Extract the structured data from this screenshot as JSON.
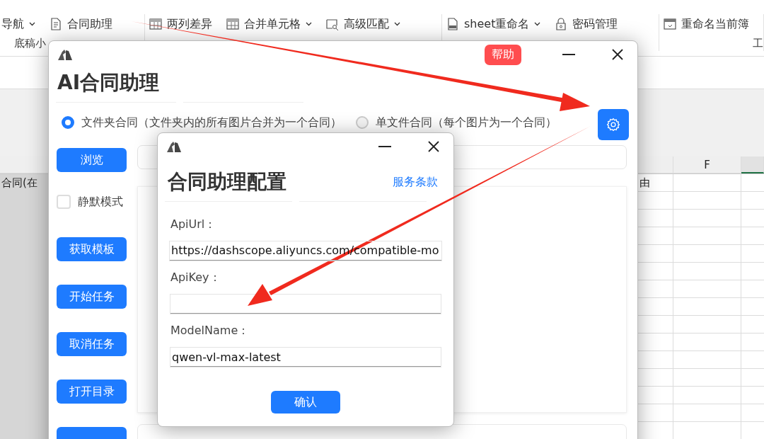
{
  "ribbon": {
    "groups": [
      {
        "label": "底稿小",
        "items": [
          {
            "label": "导航",
            "dropdown": true
          },
          {
            "label": "合同助理",
            "dropdown": false
          }
        ]
      },
      {
        "items": [
          {
            "label": "两列差异",
            "dropdown": false
          },
          {
            "label": "合并单元格",
            "dropdown": true
          },
          {
            "label": "高级匹配",
            "dropdown": true
          }
        ]
      },
      {
        "items": [
          {
            "label": "sheet重命名",
            "dropdown": true
          },
          {
            "label": "密码管理",
            "dropdown": false
          }
        ]
      },
      {
        "label": "工",
        "items": [
          {
            "label": "重命名当前簿",
            "dropdown": false
          }
        ]
      }
    ]
  },
  "sheet": {
    "column_header": "F",
    "cells": [
      "合同(在",
      "由"
    ]
  },
  "main_window": {
    "help_button": "帮助",
    "title": "AI合同助理",
    "modes": [
      {
        "label": "文件夹合同（文件夹内的所有图片合并为一个合同）",
        "selected": true
      },
      {
        "label": "单文件合同（每个图片为一个合同）",
        "selected": false
      }
    ],
    "controls": [
      {
        "kind": "button",
        "label": "浏览"
      },
      {
        "kind": "checkbox",
        "label": "静默模式",
        "checked": false
      },
      {
        "kind": "button",
        "label": "获取模板"
      },
      {
        "kind": "button",
        "label": "开始任务"
      },
      {
        "kind": "button",
        "label": "取消任务"
      },
      {
        "kind": "button",
        "label": "打开目录"
      },
      {
        "kind": "button_cut"
      }
    ]
  },
  "dialog": {
    "title": "合同助理配置",
    "terms_link": "服务条款",
    "fields": [
      {
        "label": "ApiUrl：",
        "value": "https://dashscope.aliyuncs.com/compatible-mo"
      },
      {
        "label": "ApiKey："
      },
      {
        "label": "ModelName：",
        "value": "qwen-vl-max-latest"
      }
    ],
    "confirm_button": "确认"
  }
}
